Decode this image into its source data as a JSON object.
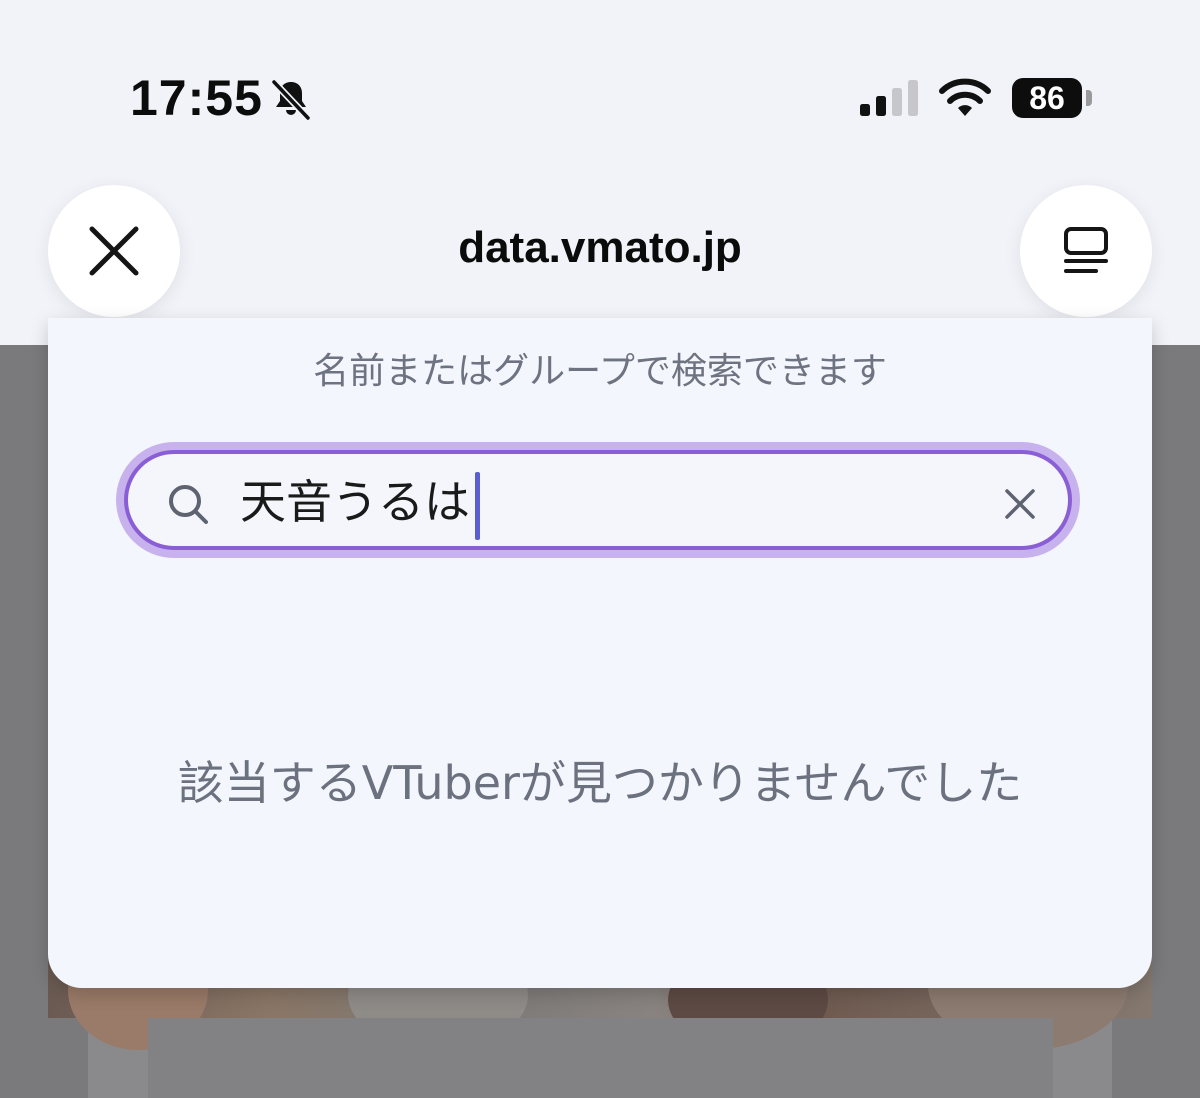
{
  "status_bar": {
    "time": "17:55",
    "battery_level": "86",
    "icons": [
      "bell-slash-icon",
      "cellular-signal-icon",
      "wifi-icon",
      "battery-icon"
    ]
  },
  "browser": {
    "url": "data.vmato.jp",
    "close_icon": "close-icon",
    "menu_icon": "tabs-menu-icon"
  },
  "search": {
    "hint": "名前またはグループで検索できます",
    "value": "天音うるは",
    "search_icon": "search-icon",
    "clear_icon": "clear-icon",
    "focus_color": "#8a5fd6"
  },
  "results": {
    "empty_message": "該当するVTuberが見つかりませんでした"
  }
}
